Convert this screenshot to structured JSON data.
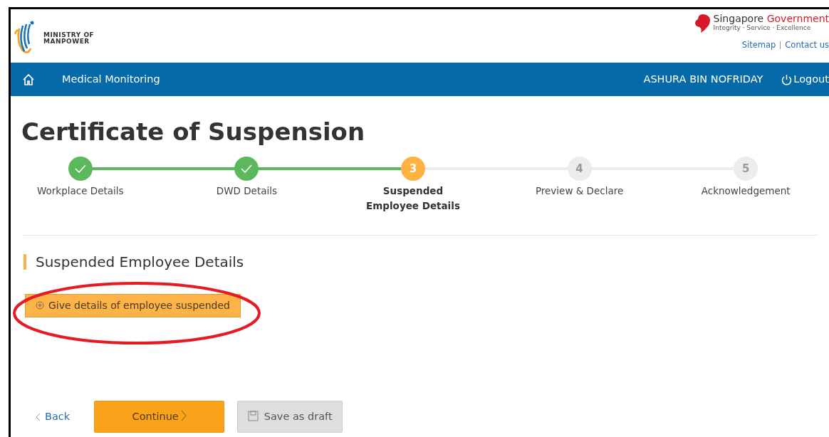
{
  "header": {
    "logo_line1": "MINISTRY OF",
    "logo_line2": "MANPOWER",
    "gov_name_part1": "Singapore",
    "gov_name_part2": "Government",
    "gov_motto": "Integrity · Service · Excellence",
    "links": [
      "Sitemap",
      "Contact us"
    ]
  },
  "navbar": {
    "title": "Medical Monitoring",
    "user": "ASHURA BIN NOFRIDAY",
    "logout": "Logout"
  },
  "page_title": "Certificate of Suspension",
  "steps": [
    {
      "label": "Workplace Details",
      "completed": true,
      "selected": false
    },
    {
      "label": "DWD Details",
      "completed": true,
      "selected": false
    },
    {
      "marker": "3",
      "label": "Suspended Employee Details",
      "completed": false,
      "selected": true
    },
    {
      "marker": "4",
      "label": "Preview & Declare",
      "completed": false,
      "selected": false
    },
    {
      "marker": "5",
      "label": "Acknowledgement",
      "completed": false,
      "selected": false
    }
  ],
  "section_title": "Suspended Employee Details",
  "add_button": "Give details of employee suspended",
  "footer": {
    "back": "Back",
    "continue": "Continue",
    "save": "Save as draft"
  }
}
